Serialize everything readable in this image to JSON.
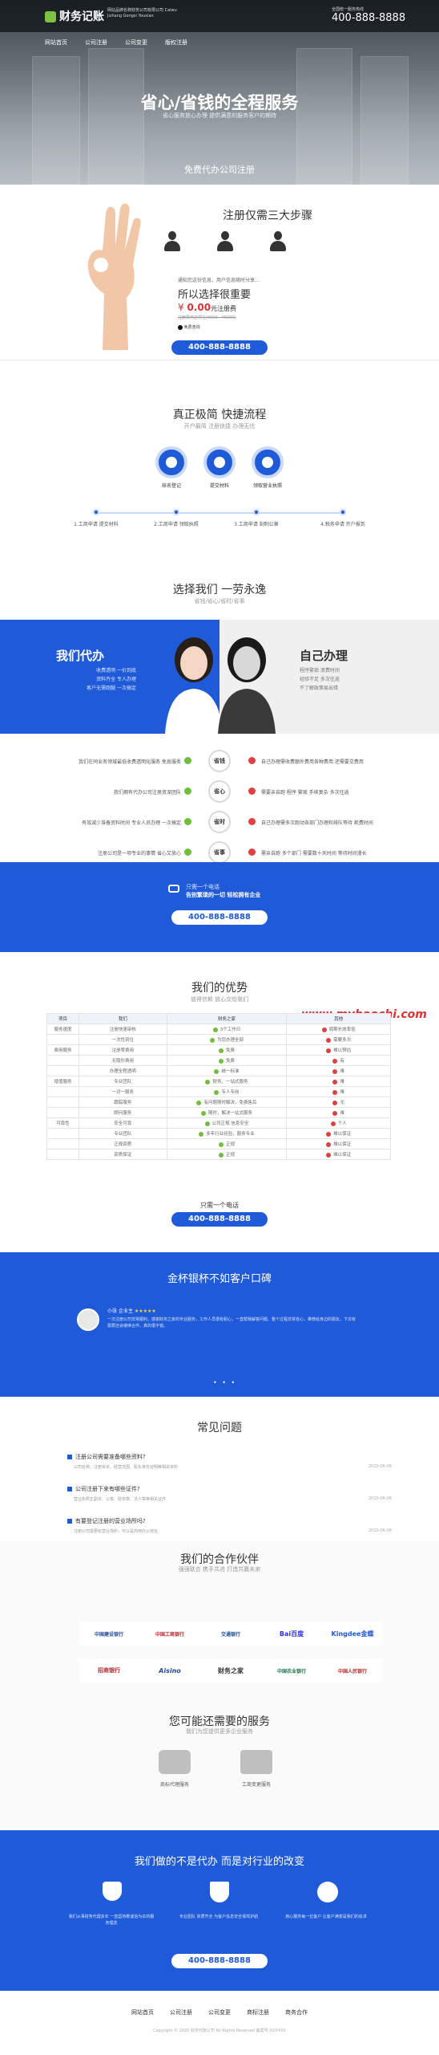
{
  "header": {
    "logo": "财务记账",
    "logo_sub": "网站品牌名称财务公司有限公司 Caiwu Jizhang Gongsi Youxian",
    "hotline_label": "全国统一服务热线",
    "hotline": "400-888-8888"
  },
  "nav": {
    "items": [
      "网站首页",
      "公司注册",
      "公司变更",
      "版权注册"
    ]
  },
  "hero": {
    "title": "省心/省钱的全程服务",
    "subtitle": "省心服务放心办理 提供满意的服务客户的期待",
    "tag": "免费代办公司注册"
  },
  "register": {
    "title": "注册仅需三大步骤",
    "lead": "通知您这份信息，用户信息随时分享...",
    "headline": "所以选择很重要",
    "price": "0.00",
    "price_suffix": "元注册费",
    "strike": "注册费用正常在(¥500 - ¥5000)",
    "call_label": "免费咨询",
    "phone": "400-888-8888"
  },
  "flow": {
    "title": "真正极简 快捷流程",
    "subtitle": "开户最简 注册快捷 办理无忧",
    "icons": [
      "核名登记",
      "提交材料",
      "领取营业执照"
    ],
    "steps": [
      "1.工商申请 提交材料",
      "2.工商申请 领取执照",
      "3.工商申请 刻制公章",
      "4.税务申请 开户报到"
    ]
  },
  "choose": {
    "title": "选择我们 一劳永逸",
    "subtitle": "省钱/省心/省时/省事",
    "left_title": "我们代办",
    "left_lines": [
      "收费透明 一价到底",
      "资料齐全 专人办理",
      "客户无需跑腿 一次搞定"
    ],
    "right_title": "自己办理",
    "right_lines": [
      "程序繁琐 浪费时间",
      "经验不足 多次往返",
      "不了解政策易出错"
    ],
    "rows": [
      {
        "left": "我们在同业务领域最低收费透明化服务 免息服务",
        "btn": "省钱",
        "right": "自己办理需收费额外费用各种费用 还需要交费用"
      },
      {
        "left": "我们拥有代办公司注册资深团队",
        "btn": "省心",
        "right": "需要亲自跑 程序 繁琐 手续复杂 多次往返"
      },
      {
        "left": "有效减少准备资料时间 专业人员办理 一次搞定",
        "btn": "省时",
        "right": "自己办理需多次跑动各部门办理和排队等待 耗费时间"
      },
      {
        "left": "注册公司是一项专业的事情 省心又放心",
        "btn": "省事",
        "right": "需亲自跑 多个部门 需要数十天时间 等待时间漫长"
      }
    ]
  },
  "cta1": {
    "line1": "只需一个电话",
    "line2": "告别繁琐的一切 轻松拥有企业",
    "phone": "400-888-8888"
  },
  "advantage": {
    "title": "我们的优势",
    "subtitle": "值得信赖 放心交给我们",
    "cols": [
      "项目",
      "我们",
      "财务之家",
      "其他"
    ],
    "rows": [
      [
        "服务速度",
        "注册快速审核",
        "3个工作日",
        "周期长效率低"
      ],
      [
        "",
        "一次性到位",
        "为您办理全部",
        "需要多次"
      ],
      [
        "费用服务",
        "注册零费用",
        "免费",
        "难以预估"
      ],
      [
        "",
        "无隐形费用",
        "免费",
        "有"
      ],
      [
        "",
        "办理全程透明",
        "统一标准",
        "难"
      ],
      [
        "增值服务",
        "专业团队",
        "财务、一站式服务",
        "难"
      ],
      [
        "",
        "一对一服务",
        "专人专岗",
        "难"
      ],
      [
        "",
        "跟踪服务",
        "有问题随时解决，免费售后",
        "无"
      ],
      [
        "",
        "顾问服务",
        "随时，解决一站式服务",
        "难"
      ],
      [
        "可靠性",
        "安全可靠",
        "公司正规 信息安全",
        "个人"
      ],
      [
        "",
        "专业团队",
        "多年行业经验，服务专业",
        "难以保证"
      ],
      [
        "",
        "正规资质",
        "正规",
        "难以保证"
      ],
      [
        "",
        "资质保证",
        "正规",
        "难以保证"
      ]
    ],
    "call_line": "只需一个电话",
    "phone": "400-888-8888"
  },
  "watermark": "www.myhaochi.com",
  "reviews": {
    "title": "金杯银杯不如客户口碑",
    "name": "小张",
    "role": "企业主",
    "stars": "★★★★★",
    "text": "一次注册公司非常顺利，感谢财务之家的专业服务，工作人员很有耐心，一直帮我解答问题，整个过程非常省心，推荐给身边的朋友，下次有需要还会继续合作，真的很不错。"
  },
  "faq": {
    "title": "常见问题",
    "items": [
      {
        "q": "注册公司需要准备哪些资料?",
        "a": "公司名称、注册资本、经营范围、股东身份证明等相关资料",
        "d": "2020-06-06"
      },
      {
        "q": "公司注册下来有哪些证件?",
        "a": "营业执照正副本、公章、财务章、法人章等相关证件",
        "d": "2020-06-06"
      },
      {
        "q": "有要登记注册的营业场所吗?",
        "a": "注册公司需要有营业场所，可以是商用办公地址",
        "d": "2020-06-06"
      }
    ]
  },
  "partners": {
    "title": "我们的合作伙伴",
    "subtitle": "强强联合 携手共进 打造共赢未来",
    "logos": [
      "中国建设银行",
      "中国工商银行",
      "交通银行",
      "Bai百度",
      "Kingdee金蝶",
      "招商银行",
      "Aisino",
      "财务之家",
      "中国农业银行",
      "中国人民银行"
    ]
  },
  "services": {
    "title": "您可能还需要的服务",
    "subtitle": "我们为您提供更多企业服务",
    "items": [
      "商标代理服务",
      "工商变更服务"
    ]
  },
  "change": {
    "title": "我们做的不是代办 而是对行业的改变",
    "cols": [
      {
        "text": "我们从事财务代理多年 一直坚持着诚信为本的服务理念"
      },
      {
        "text": "专业团队 资质齐全 为客户信息安全保驾护航"
      },
      {
        "text": "用心服务每一位客户 让客户满意是我们的追求"
      }
    ],
    "phone": "400-888-8888"
  },
  "footer": {
    "links": [
      "网站首页",
      "公司注册",
      "公司变更",
      "商标注册",
      "商务合作"
    ],
    "copyright": "Copyright © 2020 财务代账公司 All Rights Reserved 备案号:XXXXXX"
  },
  "colors": {
    "accent": "#1f5ad9",
    "green": "#6fbf3a",
    "red": "#e04040"
  }
}
